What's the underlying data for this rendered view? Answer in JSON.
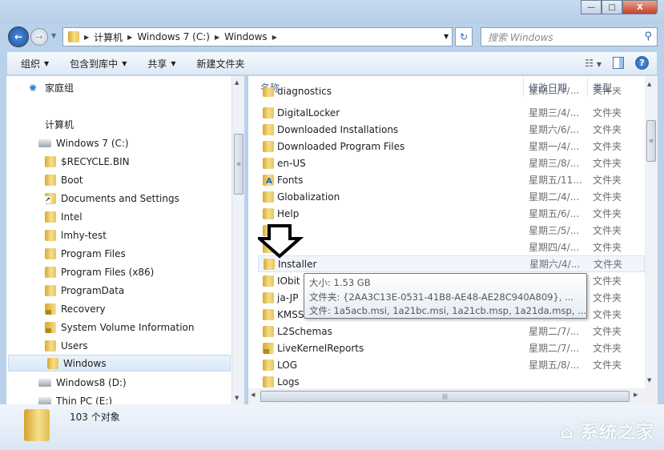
{
  "window": {
    "minimize": "—",
    "maximize": "□",
    "close": "X"
  },
  "address": {
    "crumbs": [
      "计算机",
      "Windows 7  (C:)",
      "Windows"
    ],
    "search_placeholder": "搜索 Windows"
  },
  "toolbar": {
    "organize": "组织",
    "include_library": "包含到库中",
    "share": "共享",
    "new_folder": "新建文件夹",
    "help": "?"
  },
  "sidebar": {
    "items": [
      {
        "label": "家庭组",
        "icon": "homegroup-icon",
        "indent": 0
      },
      {
        "label": "计算机",
        "icon": "computer-icon",
        "indent": 0
      },
      {
        "label": "Windows 7  (C:)",
        "icon": "drive-icon",
        "indent": 1
      },
      {
        "label": "$RECYCLE.BIN",
        "icon": "folder-icon",
        "indent": 2
      },
      {
        "label": "Boot",
        "icon": "folder-icon",
        "indent": 2
      },
      {
        "label": "Documents and Settings",
        "icon": "shortcut-folder-icon",
        "indent": 2
      },
      {
        "label": "Intel",
        "icon": "folder-icon",
        "indent": 2
      },
      {
        "label": "lmhy-test",
        "icon": "folder-icon",
        "indent": 2
      },
      {
        "label": "Program Files",
        "icon": "folder-icon",
        "indent": 2
      },
      {
        "label": "Program Files (x86)",
        "icon": "folder-icon",
        "indent": 2
      },
      {
        "label": "ProgramData",
        "icon": "folder-icon",
        "indent": 2
      },
      {
        "label": "Recovery",
        "icon": "locked-folder-icon",
        "indent": 2
      },
      {
        "label": "System Volume Information",
        "icon": "locked-folder-icon",
        "indent": 2
      },
      {
        "label": "Users",
        "icon": "folder-icon",
        "indent": 2
      },
      {
        "label": "Windows",
        "icon": "folder-icon",
        "indent": 2,
        "selected": true
      },
      {
        "label": "Windows8 (D:)",
        "icon": "drive-icon",
        "indent": 1
      },
      {
        "label": "Thin PC (E:)",
        "icon": "drive-icon",
        "indent": 1
      }
    ]
  },
  "columns": {
    "name": "名称",
    "date": "修改日期",
    "type": "类型"
  },
  "files": [
    {
      "name": "diagnostics",
      "date": "星期二/7/...",
      "type": "文件夹",
      "partial": true
    },
    {
      "name": "DigitalLocker",
      "date": "星期三/4/...",
      "type": "文件夹"
    },
    {
      "name": "Downloaded Installations",
      "date": "星期六/6/...",
      "type": "文件夹"
    },
    {
      "name": "Downloaded Program Files",
      "date": "星期一/4/...",
      "type": "文件夹"
    },
    {
      "name": "en-US",
      "date": "星期三/8/...",
      "type": "文件夹"
    },
    {
      "name": "Fonts",
      "date": "星期五/11...",
      "type": "文件夹",
      "icon": "fonts-folder-icon"
    },
    {
      "name": "Globalization",
      "date": "星期二/4/...",
      "type": "文件夹"
    },
    {
      "name": "Help",
      "date": "星期五/6/...",
      "type": "文件夹"
    },
    {
      "name": "",
      "date": "星期三/5/...",
      "type": "文件夹"
    },
    {
      "name": "",
      "date": "星期四/4/...",
      "type": "文件夹"
    },
    {
      "name": "Installer",
      "date": "星期六/4/...",
      "type": "文件夹",
      "hover": true
    },
    {
      "name": "IObit",
      "date": "",
      "type": "文件夹"
    },
    {
      "name": "ja-JP",
      "date": "",
      "type": "文件夹"
    },
    {
      "name": "KMSS",
      "date": "",
      "type": "文件夹"
    },
    {
      "name": "L2Schemas",
      "date": "星期二/7/...",
      "type": "文件夹"
    },
    {
      "name": "LiveKernelReports",
      "date": "星期二/7/...",
      "type": "文件夹",
      "icon": "locked-folder-icon"
    },
    {
      "name": "LOG",
      "date": "星期五/8/...",
      "type": "文件夹"
    },
    {
      "name": "Logs",
      "date": "",
      "type": ""
    }
  ],
  "tooltip": {
    "size": "大小: 1.53 GB",
    "folders": "文件夹: {2AA3C13E-0531-41B8-AE48-AE28C940A809}, ...",
    "files": "文件: 1a5acb.msi, 1a21bc.msi, 1a21cb.msp, 1a21da.msp, ..."
  },
  "status": {
    "count": "103 个对象"
  },
  "watermark": "系统之家"
}
